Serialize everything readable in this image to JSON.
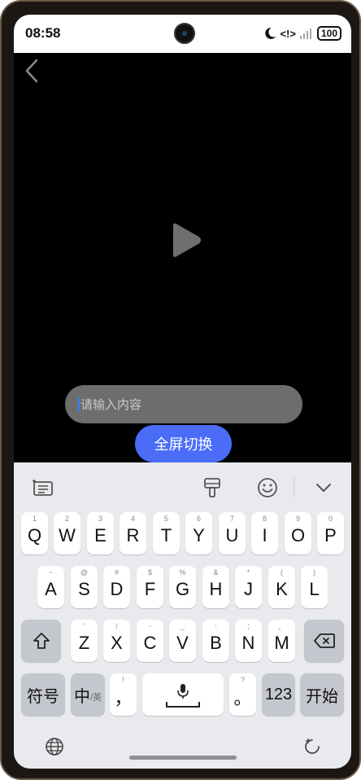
{
  "status_bar": {
    "time": "08:58",
    "signal_text": "<!>",
    "battery": "100"
  },
  "video": {
    "input_placeholder": "请输入内容",
    "fullscreen_button": "全屏切换"
  },
  "keyboard": {
    "row1": [
      {
        "key": "Q",
        "sub": "1"
      },
      {
        "key": "W",
        "sub": "2"
      },
      {
        "key": "E",
        "sub": "3"
      },
      {
        "key": "R",
        "sub": "4"
      },
      {
        "key": "T",
        "sub": "5"
      },
      {
        "key": "Y",
        "sub": "6"
      },
      {
        "key": "U",
        "sub": "7"
      },
      {
        "key": "I",
        "sub": "8"
      },
      {
        "key": "O",
        "sub": "9"
      },
      {
        "key": "P",
        "sub": "0"
      }
    ],
    "row2": [
      {
        "key": "A",
        "sub": "~"
      },
      {
        "key": "S",
        "sub": "@"
      },
      {
        "key": "D",
        "sub": "#"
      },
      {
        "key": "F",
        "sub": "$"
      },
      {
        "key": "G",
        "sub": "%"
      },
      {
        "key": "H",
        "sub": "&"
      },
      {
        "key": "J",
        "sub": "*"
      },
      {
        "key": "K",
        "sub": "("
      },
      {
        "key": "L",
        "sub": ")"
      }
    ],
    "row3": [
      {
        "key": "Z",
        "sub": "'"
      },
      {
        "key": "X",
        "sub": "/"
      },
      {
        "key": "C",
        "sub": "-"
      },
      {
        "key": "V",
        "sub": "_"
      },
      {
        "key": "B",
        "sub": ":"
      },
      {
        "key": "N",
        "sub": ";"
      },
      {
        "key": "M",
        "sub": "、"
      }
    ],
    "symbols_key": "符号",
    "lang_key_main": "中",
    "lang_key_sub": "/英",
    "comma_key": "，",
    "comma_sub": "!",
    "period_key": "。",
    "period_sub": "?",
    "numbers_key": "123",
    "enter_key": "开始"
  }
}
